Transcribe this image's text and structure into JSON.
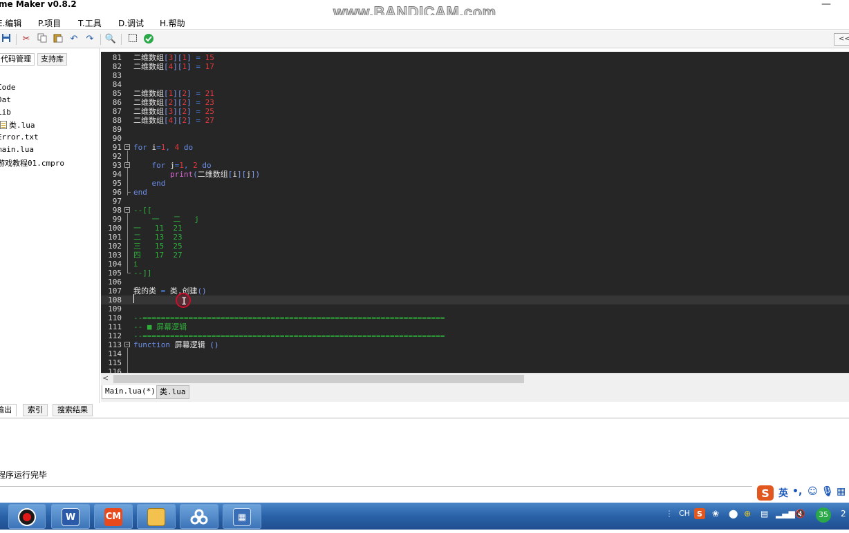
{
  "window": {
    "title": "me Maker  v0.8.2",
    "watermark": "www.BANDICAM.com",
    "minimize_glyph": "—"
  },
  "menu": [
    "E.编辑",
    "P.项目",
    "T.工具",
    "D.调试",
    "H.帮助"
  ],
  "toolbar": {
    "icons": [
      "save-icon",
      "cut-icon",
      "copy-icon",
      "paste-icon",
      "undo-icon",
      "redo-icon",
      "search-icon",
      "select-icon",
      "check-icon"
    ],
    "collapse_label": "<<"
  },
  "left_panel": {
    "tabs": [
      "代码管理",
      "支持库"
    ],
    "tree": [
      "Code",
      "Dat",
      "Lib",
      "类.lua",
      "Error.txt",
      "main.lua",
      "游戏教程01.cmpro"
    ]
  },
  "editor": {
    "lines": [
      {
        "n": "81",
        "code": "二维数组[3][1] = 15"
      },
      {
        "n": "82",
        "code": "二维数组[4][1] = 17"
      },
      {
        "n": "83",
        "code": ""
      },
      {
        "n": "84",
        "code": ""
      },
      {
        "n": "85",
        "code": "二维数组[1][2] = 21"
      },
      {
        "n": "86",
        "code": "二维数组[2][2] = 23"
      },
      {
        "n": "87",
        "code": "二维数组[3][2] = 25"
      },
      {
        "n": "88",
        "code": "二维数组[4][2] = 27"
      },
      {
        "n": "89",
        "code": ""
      },
      {
        "n": "90",
        "code": ""
      },
      {
        "n": "91",
        "code": "for i=1, 4 do"
      },
      {
        "n": "92",
        "code": ""
      },
      {
        "n": "93",
        "code": "    for j=1, 2 do"
      },
      {
        "n": "94",
        "code": "        print(二维数组[i][j])"
      },
      {
        "n": "95",
        "code": "    end"
      },
      {
        "n": "96",
        "code": "end"
      },
      {
        "n": "97",
        "code": ""
      },
      {
        "n": "98",
        "code": "--[["
      },
      {
        "n": "99",
        "code": "    一   二   j"
      },
      {
        "n": "100",
        "code": "一   11  21"
      },
      {
        "n": "101",
        "code": "二   13  23"
      },
      {
        "n": "102",
        "code": "三   15  25"
      },
      {
        "n": "103",
        "code": "四   17  27"
      },
      {
        "n": "104",
        "code": "i"
      },
      {
        "n": "105",
        "code": "--]]"
      },
      {
        "n": "106",
        "code": ""
      },
      {
        "n": "107",
        "code": "我的类 = 类.创建()"
      },
      {
        "n": "108",
        "code": ""
      },
      {
        "n": "109",
        "code": ""
      },
      {
        "n": "110",
        "code": "--=================================================================="
      },
      {
        "n": "111",
        "code": "-- ■ 屏幕逻辑"
      },
      {
        "n": "112",
        "code": "--=================================================================="
      },
      {
        "n": "113",
        "code": "function 屏幕逻辑 ()"
      },
      {
        "n": "114",
        "code": ""
      },
      {
        "n": "115",
        "code": ""
      },
      {
        "n": "116",
        "code": ""
      }
    ],
    "current_line": "108"
  },
  "doc_tabs": [
    "Main.lua(*)",
    "类.lua"
  ],
  "bottom_tabs": [
    "输出",
    "索引",
    "搜索结果"
  ],
  "output": {
    "text": "程序运行完毕"
  },
  "ime": {
    "language": "英"
  },
  "tray": {
    "lang": "CH",
    "badge": "35",
    "clock_fragment": "2"
  },
  "colors": {
    "editor_bg": "#262626",
    "keyword": "#6b8ee8",
    "number": "#e5393d",
    "comment": "#2eaf3a",
    "taskbar": "#2a62a8"
  }
}
